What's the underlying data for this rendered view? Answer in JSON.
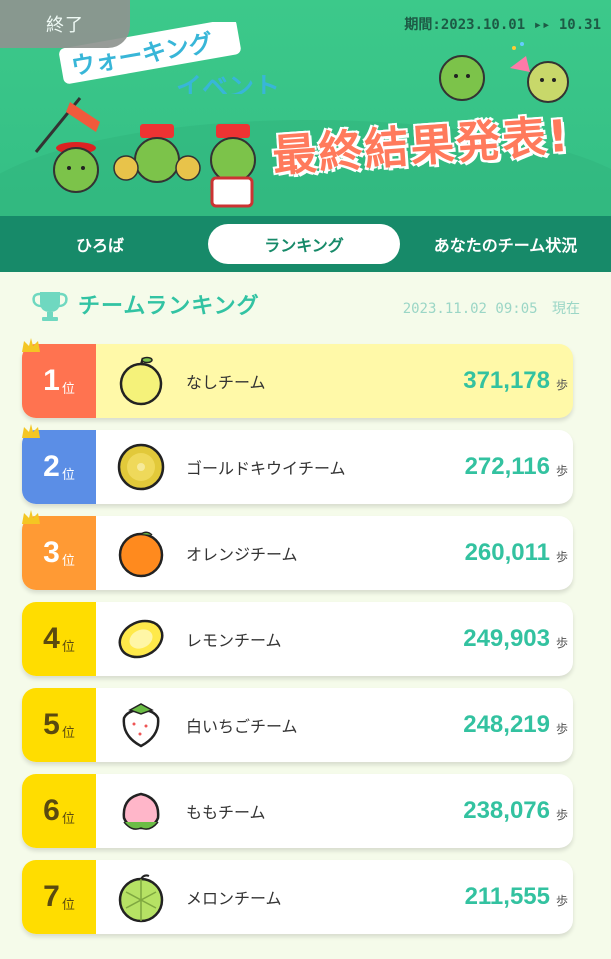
{
  "banner": {
    "end_badge": "終了",
    "period": "期間:2023.10.01 ▸▸ 10.31",
    "title_line1": "ウォーキング",
    "title_line2": "イベント",
    "final_results": "最終結果発表!"
  },
  "tabs": [
    {
      "label": "ひろば"
    },
    {
      "label": "ランキング"
    },
    {
      "label": "あなたのチーム状況"
    }
  ],
  "ranking": {
    "title": "チームランキング",
    "as_of": "2023.11.02 09:05",
    "as_of_suffix": "現在",
    "rank_suffix": "位",
    "unit": "歩",
    "colors": {
      "rank1": "#ff7350",
      "rank2": "#5b8ee6",
      "rank3": "#ff9a34",
      "rank_other": "#ffdd00",
      "steps": "#33c2a0"
    },
    "rows": [
      {
        "rank": "1",
        "icon": "pear-icon",
        "name": "なしチーム",
        "steps": "371,178"
      },
      {
        "rank": "2",
        "icon": "golden-kiwi-icon",
        "name": "ゴールドキウイチーム",
        "steps": "272,116"
      },
      {
        "rank": "3",
        "icon": "orange-icon",
        "name": "オレンジチーム",
        "steps": "260,011"
      },
      {
        "rank": "4",
        "icon": "lemon-icon",
        "name": "レモンチーム",
        "steps": "249,903"
      },
      {
        "rank": "5",
        "icon": "white-strawberry-icon",
        "name": "白いちごチーム",
        "steps": "248,219"
      },
      {
        "rank": "6",
        "icon": "peach-icon",
        "name": "ももチーム",
        "steps": "238,076"
      },
      {
        "rank": "7",
        "icon": "melon-icon",
        "name": "メロンチーム",
        "steps": "211,555"
      }
    ]
  }
}
